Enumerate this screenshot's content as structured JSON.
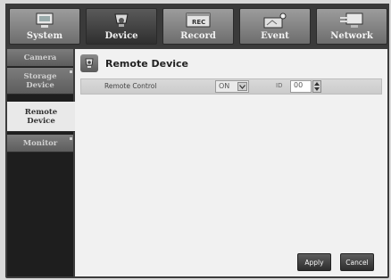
{
  "tabs": [
    {
      "label": "System",
      "icon": "system-icon",
      "active": false
    },
    {
      "label": "Device",
      "icon": "camera-icon",
      "active": true
    },
    {
      "label": "Record",
      "icon": "record-icon",
      "active": false
    },
    {
      "label": "Event",
      "icon": "event-icon",
      "active": false
    },
    {
      "label": "Network",
      "icon": "network-icon",
      "active": false
    }
  ],
  "sidebar": {
    "items": [
      {
        "label": "Camera"
      },
      {
        "label": "Storage Device"
      },
      {
        "label": "Remote Device"
      },
      {
        "label": "Monitor"
      }
    ]
  },
  "panel": {
    "title": "Remote Device",
    "icon": "remote-device-icon"
  },
  "settings": {
    "remote_control_label": "Remote Control",
    "remote_control_value": "ON",
    "id_label": "ID",
    "id_value": "00"
  },
  "buttons": {
    "apply": "Apply",
    "cancel": "Cancel"
  },
  "colors": {
    "frame": "#3c3c3c",
    "tab_inactive": "#8a8a8a",
    "tab_active": "#3a3a3a",
    "content_bg": "#f1f1f1",
    "button_bg": "#3a3a3a"
  }
}
